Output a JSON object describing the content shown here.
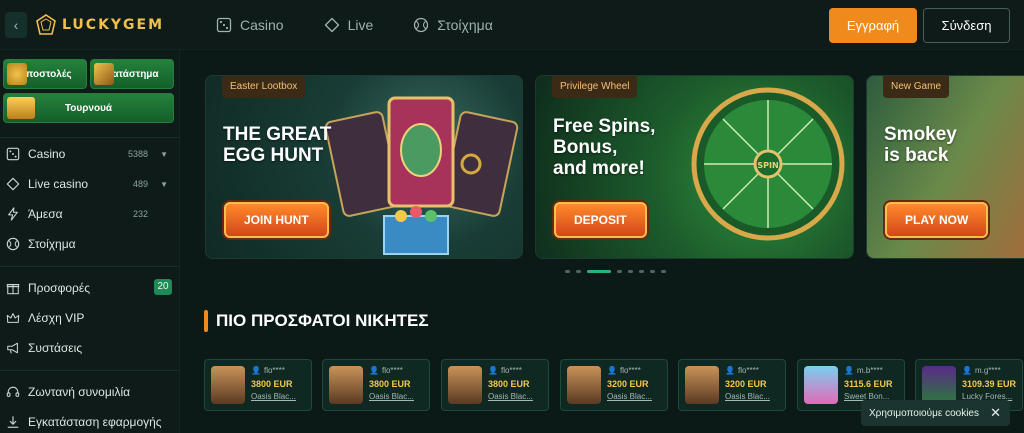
{
  "header": {
    "logo_text": "LUCKYGEM",
    "collapse_icon": "chevron-left",
    "nav": [
      {
        "label": "Casino",
        "icon": "dice-icon"
      },
      {
        "label": "Live",
        "icon": "diamond-icon"
      },
      {
        "label": "Στοίχημα",
        "icon": "ball-icon"
      }
    ],
    "register_label": "Εγγραφή",
    "login_label": "Σύνδεση"
  },
  "sidebar": {
    "promos": {
      "missions": "Αποστολές",
      "shop": "Κατάστημα",
      "tournaments": "Τουρνουά"
    },
    "items": [
      {
        "label": "Casino",
        "count": "5388",
        "icon": "dice-icon"
      },
      {
        "label": "Live casino",
        "count": "489",
        "icon": "diamond-icon"
      },
      {
        "label": "Άμεσα",
        "count": "232",
        "icon": "bolt-icon"
      },
      {
        "label": "Στοίχημα",
        "icon": "ball-icon"
      },
      {
        "label": "Προσφορές",
        "badge": "20",
        "icon": "gift-icon"
      },
      {
        "label": "Λέσχη VIP",
        "icon": "crown-icon"
      },
      {
        "label": "Συστάσεις",
        "icon": "megaphone-icon"
      },
      {
        "label": "Ζωντανή συνομιλία",
        "icon": "headset-icon"
      },
      {
        "label": "Εγκατάσταση εφαρμογής",
        "icon": "download-icon"
      }
    ]
  },
  "banners": [
    {
      "tag": "Easter Lootbox",
      "title": "THE GREAT\nEGG HUNT",
      "button": "JOIN HUNT"
    },
    {
      "tag": "Privilege Wheel",
      "title": "Free Spins,\nBonus,\nand more!",
      "button": "DEPOSIT"
    },
    {
      "tag": "New Game",
      "title": "Smokey\nis back",
      "button": "PLAY NOW"
    }
  ],
  "carousel": {
    "count": 8,
    "active": 2
  },
  "winners": {
    "title": "ΠΙΟ ΠΡΟΣΦΑΤΟΙ ΝΙΚΗΤΕΣ",
    "cards": [
      {
        "user": "flo****",
        "amount": "3800 EUR",
        "game": "Oasis Blac..."
      },
      {
        "user": "flo****",
        "amount": "3800 EUR",
        "game": "Oasis Blac..."
      },
      {
        "user": "flo****",
        "amount": "3800 EUR",
        "game": "Oasis Blac..."
      },
      {
        "user": "flo****",
        "amount": "3200 EUR",
        "game": "Oasis Blac..."
      },
      {
        "user": "flo****",
        "amount": "3200 EUR",
        "game": "Oasis Blac..."
      },
      {
        "user": "m.b****",
        "amount": "3115.6 EUR",
        "game": "Sweet Bon..."
      },
      {
        "user": "m.g****",
        "amount": "3109.39 EUR",
        "game": "Lucky Fores..."
      }
    ]
  },
  "cookie": {
    "text": "Χρησιμοποιούμε cookies"
  },
  "colors": {
    "accent": "#f08a1c",
    "brand": "#f2c04a",
    "background": "#0c1a17",
    "active": "#2fb07a"
  }
}
